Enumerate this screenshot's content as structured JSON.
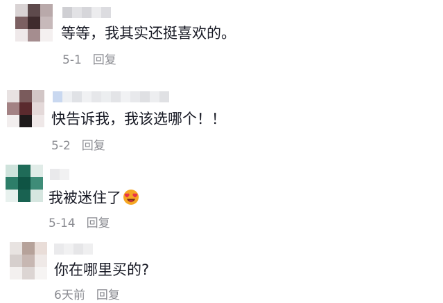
{
  "comments": [
    {
      "text": "等等，我其实还挺喜欢的。",
      "date": "5-1",
      "reply_label": "回复"
    },
    {
      "text": "快告诉我，我该选哪个！！",
      "date": "5-2",
      "reply_label": "回复"
    },
    {
      "text": "我被迷住了",
      "emoji": "heart-eyes-emoji",
      "date": "5-14",
      "reply_label": "回复"
    },
    {
      "text": "你在哪里买的?",
      "date": "6天前",
      "reply_label": "回复"
    }
  ],
  "colors": {
    "comment_text": "#161823",
    "meta_text": "#8a8b91",
    "emoji_face": "#f5a623",
    "emoji_heart": "#e8344a"
  }
}
